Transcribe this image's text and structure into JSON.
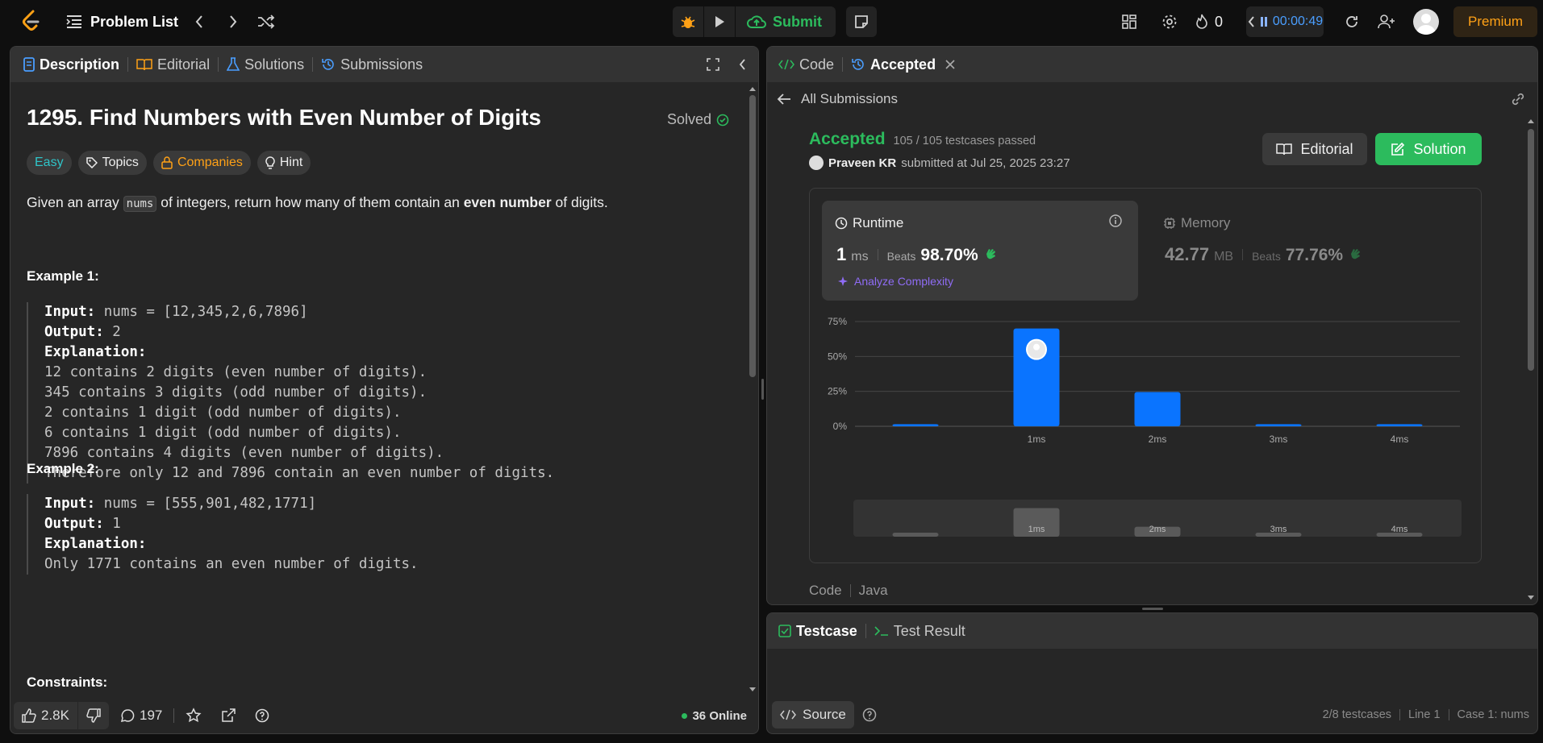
{
  "topbar": {
    "problem_list": "Problem List",
    "submit": "Submit",
    "streak": "0",
    "timer": "00:00:49",
    "premium": "Premium"
  },
  "left": {
    "tabs": [
      "Description",
      "Editorial",
      "Solutions",
      "Submissions"
    ],
    "title": "1295. Find Numbers with Even Number of Digits",
    "solved": "Solved",
    "tags": {
      "easy": "Easy",
      "topics": "Topics",
      "companies": "Companies",
      "hint": "Hint"
    },
    "desc_pre": "Given an array ",
    "desc_code": "nums",
    "desc_mid": " of integers, return how many of them contain an ",
    "desc_bold": "even number",
    "desc_post": " of digits.",
    "ex1_title": "Example 1:",
    "ex1": {
      "input_label": "Input:",
      "input": " nums = [12,345,2,6,7896]",
      "output_label": "Output:",
      "output": " 2",
      "expl_label": "Explanation:",
      "lines": [
        "12 contains 2 digits (even number of digits).",
        "345 contains 3 digits (odd number of digits).",
        "2 contains 1 digit (odd number of digits).",
        "6 contains 1 digit (odd number of digits).",
        "7896 contains 4 digits (even number of digits).",
        "Therefore only 12 and 7896 contain an even number of digits."
      ]
    },
    "ex2_title": "Example 2:",
    "ex2": {
      "input_label": "Input:",
      "input": " nums = [555,901,482,1771]",
      "output_label": "Output:",
      "output": " 1",
      "expl_label": "Explanation:",
      "lines": [
        "Only 1771 contains an even number of digits."
      ]
    },
    "constraints": "Constraints:",
    "footer": {
      "likes": "2.8K",
      "comments": "197",
      "online": "36 Online"
    }
  },
  "right": {
    "tabs": {
      "code": "Code",
      "accepted": "Accepted"
    },
    "all_submissions": "All Submissions",
    "status": "Accepted",
    "testcases": "105 / 105 testcases passed",
    "user": "Praveen KR",
    "submitted": " submitted at Jul 25, 2025 23:27",
    "editorial_btn": "Editorial",
    "solution_btn": "Solution",
    "runtime": {
      "label": "Runtime",
      "value": "1",
      "unit": "ms",
      "beats_label": "Beats",
      "beats": "98.70%",
      "analyze": "Analyze Complexity"
    },
    "memory": {
      "label": "Memory",
      "value": "42.77",
      "unit": "MB",
      "beats_label": "Beats",
      "beats": "77.76%"
    },
    "code_label": "Code",
    "lang": "Java"
  },
  "chart_data": {
    "type": "bar",
    "categories": [
      "",
      "1ms",
      "2ms",
      "3ms",
      "4ms"
    ],
    "values": [
      1.5,
      70,
      24.5,
      1.5,
      1.5
    ],
    "ylim": [
      0,
      75
    ],
    "yticks": [
      "0%",
      "25%",
      "50%",
      "75%"
    ],
    "grid": true,
    "bar_color": "#0a74ff"
  },
  "bottom": {
    "tabs": {
      "testcase": "Testcase",
      "result": "Test Result"
    },
    "source": "Source",
    "status": [
      "2/8 testcases",
      "Line 1",
      "Case 1: nums"
    ]
  }
}
